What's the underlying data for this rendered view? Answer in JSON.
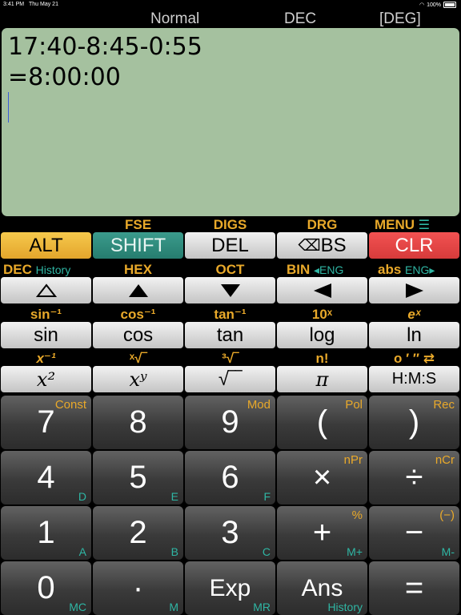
{
  "status_bar": {
    "time": "3:41 PM",
    "date": "Thu May 21",
    "battery": "100%"
  },
  "mode_bar": {
    "mode": "Normal",
    "base": "DEC",
    "angle": "[DEG]"
  },
  "display": {
    "expression": "17:40-8:45-0:55",
    "result": "=8:00:00"
  },
  "shift_labels": {
    "fse": "FSE",
    "digs": "DIGS",
    "drg": "DRG",
    "menu": "MENU"
  },
  "top_keys": {
    "alt": "ALT",
    "shift": "SHIFT",
    "del": "DEL",
    "bs": "BS",
    "clr": "CLR"
  },
  "base_labels": {
    "dec": "DEC",
    "history": "History",
    "hex": "HEX",
    "oct": "OCT",
    "bin": "BIN",
    "eng_left": "◂ENG",
    "abs": "abs",
    "eng_right": "ENG▸"
  },
  "trig_labels": {
    "asin": "sin⁻¹",
    "acos": "cos⁻¹",
    "atan": "tan⁻¹",
    "pow10": "10ˣ",
    "exp": "eˣ"
  },
  "func_keys": {
    "sin": "sin",
    "cos": "cos",
    "tan": "tan",
    "log": "log",
    "ln": "ln"
  },
  "pow_labels": {
    "inv": "x⁻¹",
    "root_x": "ˣ√‾",
    "root_3": "³√‾",
    "fact": "n!",
    "dms": "o ′ ″ ⇄"
  },
  "pow_keys": {
    "sq": "x²",
    "xy": "xʸ",
    "sqrt": "√‾‾",
    "pi": "π",
    "hms": "H:M:S"
  },
  "num_keys": [
    {
      "label": "7",
      "sup": "Const",
      "sub": ""
    },
    {
      "label": "8",
      "sup": "",
      "sub": ""
    },
    {
      "label": "9",
      "sup": "Mod",
      "sub": ""
    },
    {
      "label": "(",
      "sup": "Pol",
      "sub": ""
    },
    {
      "label": ")",
      "sup": "Rec",
      "sub": ""
    },
    {
      "label": "4",
      "sup": "",
      "sub": "D"
    },
    {
      "label": "5",
      "sup": "",
      "sub": "E"
    },
    {
      "label": "6",
      "sup": "",
      "sub": "F"
    },
    {
      "label": "×",
      "sup": "nPr",
      "sub": ""
    },
    {
      "label": "÷",
      "sup": "nCr",
      "sub": ""
    },
    {
      "label": "1",
      "sup": "",
      "sub": "A"
    },
    {
      "label": "2",
      "sup": "",
      "sub": "B"
    },
    {
      "label": "3",
      "sup": "",
      "sub": "C"
    },
    {
      "label": "+",
      "sup": "%",
      "sub": "M+"
    },
    {
      "label": "−",
      "sup": "(−)",
      "sub": "M-"
    },
    {
      "label": "0",
      "sup": "",
      "sub": "MC"
    },
    {
      "label": "·",
      "sup": "",
      "sub": "M"
    },
    {
      "label": "Exp",
      "sup": "",
      "sub": "MR"
    },
    {
      "label": "Ans",
      "sup": "",
      "sub": "History"
    },
    {
      "label": "=",
      "sup": "",
      "sub": ""
    }
  ]
}
